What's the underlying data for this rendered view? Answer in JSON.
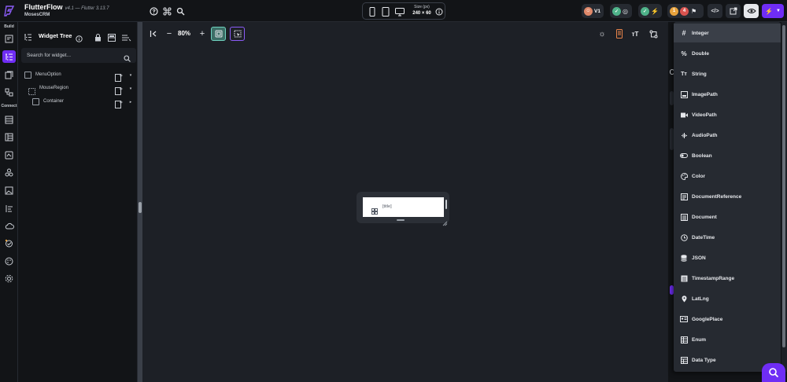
{
  "app": {
    "name": "FlutterFlow",
    "version": "v4.1 — Flutter 3.13.7",
    "project": "MosesCRM"
  },
  "device_bar": {
    "size_label": "Size (px)",
    "size_value": "240 × 60"
  },
  "top_right": {
    "version_badge": "V1",
    "count_orange": "1",
    "count_red": "4"
  },
  "rail": {
    "build_label": "Build",
    "connect_label": "Connect"
  },
  "widget_tree": {
    "title": "Widget Tree",
    "search_placeholder": "Search for widget...",
    "nodes": [
      {
        "label": "MenuOption"
      },
      {
        "label": "MouseRegion"
      },
      {
        "label": "Container"
      }
    ]
  },
  "canvas": {
    "zoom": "80%",
    "preview_text": "[title]"
  },
  "type_menu": {
    "items": [
      {
        "label": "Integer",
        "icon": "hash-icon"
      },
      {
        "label": "Double",
        "icon": "percent-icon"
      },
      {
        "label": "String",
        "icon": "text-icon"
      },
      {
        "label": "ImagePath",
        "icon": "image-icon"
      },
      {
        "label": "VideoPath",
        "icon": "video-icon"
      },
      {
        "label": "AudioPath",
        "icon": "audio-icon"
      },
      {
        "label": "Boolean",
        "icon": "toggle-icon"
      },
      {
        "label": "Color",
        "icon": "palette-icon"
      },
      {
        "label": "DocumentReference",
        "icon": "doc-ref-icon"
      },
      {
        "label": "Document",
        "icon": "document-icon"
      },
      {
        "label": "DateTime",
        "icon": "clock-icon"
      },
      {
        "label": "JSON",
        "icon": "database-icon"
      },
      {
        "label": "TimestampRange",
        "icon": "range-icon"
      },
      {
        "label": "LatLng",
        "icon": "pin-icon"
      },
      {
        "label": "GooglePlace",
        "icon": "place-icon"
      },
      {
        "label": "Enum",
        "icon": "enum-icon"
      },
      {
        "label": "Data Type",
        "icon": "table-icon"
      }
    ],
    "highlighted_index": 0
  },
  "colors": {
    "accent": "#6f2df5",
    "panel": "#121417",
    "canvas": "#1d2026",
    "menu": "#262a31"
  }
}
